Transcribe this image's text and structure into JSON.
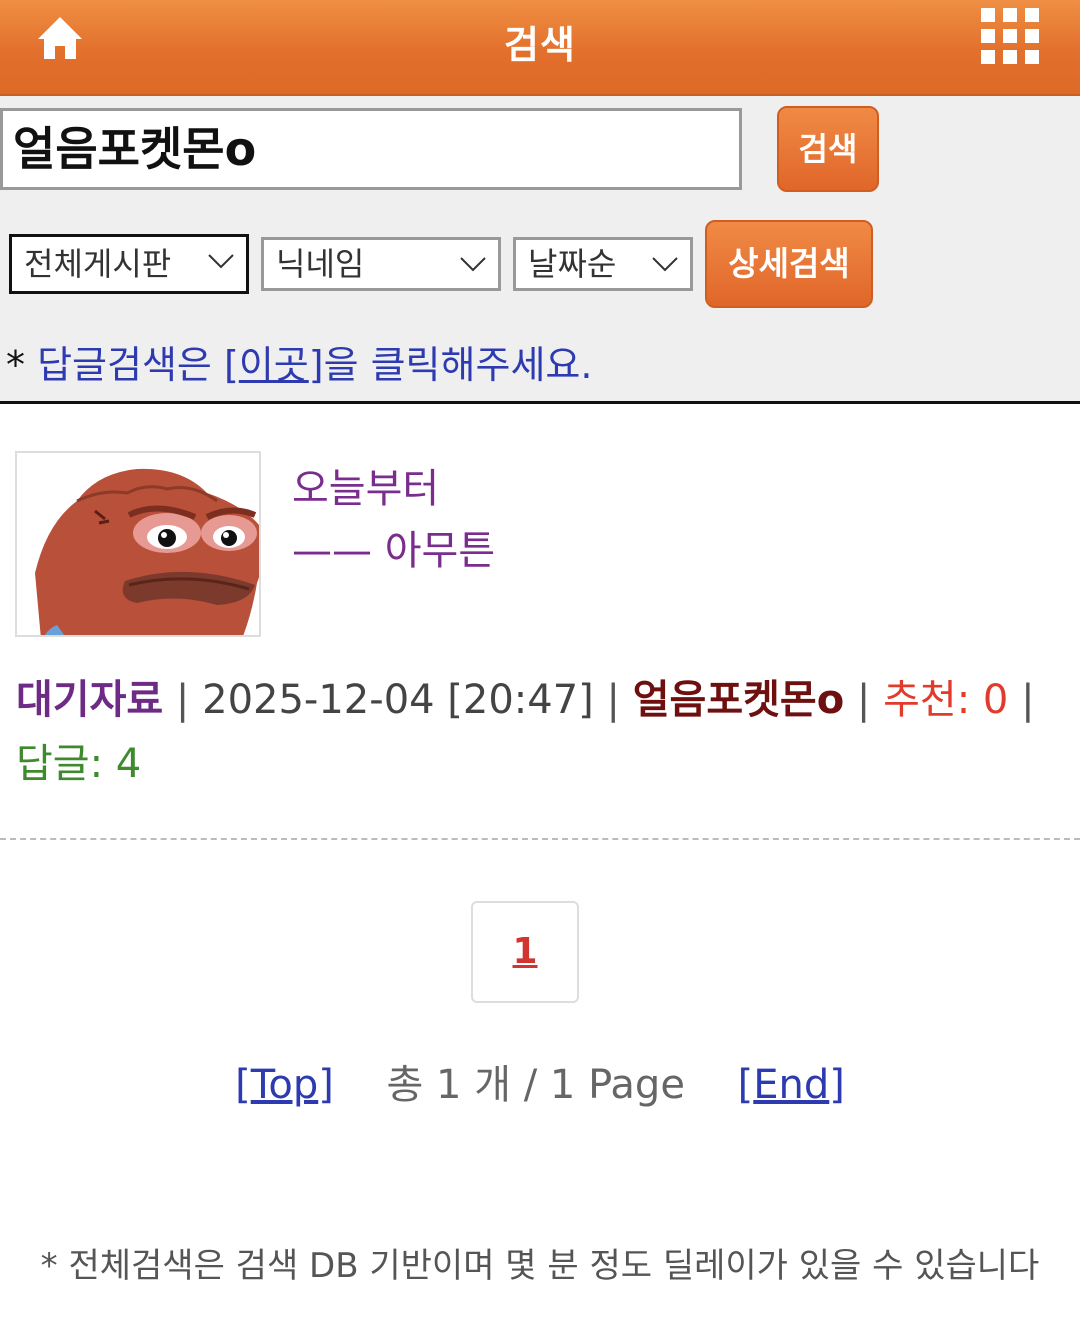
{
  "header": {
    "title": "검색",
    "home_icon": "home-icon",
    "menu_icon": "grid-menu-icon"
  },
  "search": {
    "query": "얼음포켓몬o",
    "search_button": "검색",
    "detail_button": "상세검색",
    "board_select": "전체게시판",
    "field_select": "닉네임",
    "sort_select": "날짜순"
  },
  "reply_note": {
    "prefix": "* ",
    "text_before": "답글검색은 ",
    "bracket_open": "[",
    "link": "이곳",
    "bracket_close": "]",
    "text_after": "을 클릭해주세요."
  },
  "result": {
    "title_line1": "오늘부터",
    "title_line2": "—— 아무튼",
    "category": "대기자료",
    "datetime": "2025-12-04 [20:47]",
    "nickname": "얼음포켓몬o",
    "recommend": "추천: 0",
    "replies": "답글: 4"
  },
  "pagination": {
    "current_page": "1",
    "top_link": "Top",
    "summary": "총 1 개 / 1 Page",
    "end_link": "End"
  },
  "footnote": "* 전체검색은 검색 DB 기반이며 몇 분 정도 딜레이가 있을 수 있습니다",
  "colors": {
    "header_orange": "#e2702c",
    "link_blue": "#2e3bb0",
    "title_purple": "#7a2d8c",
    "nick_maroon": "#6e1010",
    "recommend_red": "#e23b2c",
    "reply_green": "#3e8a2c"
  }
}
